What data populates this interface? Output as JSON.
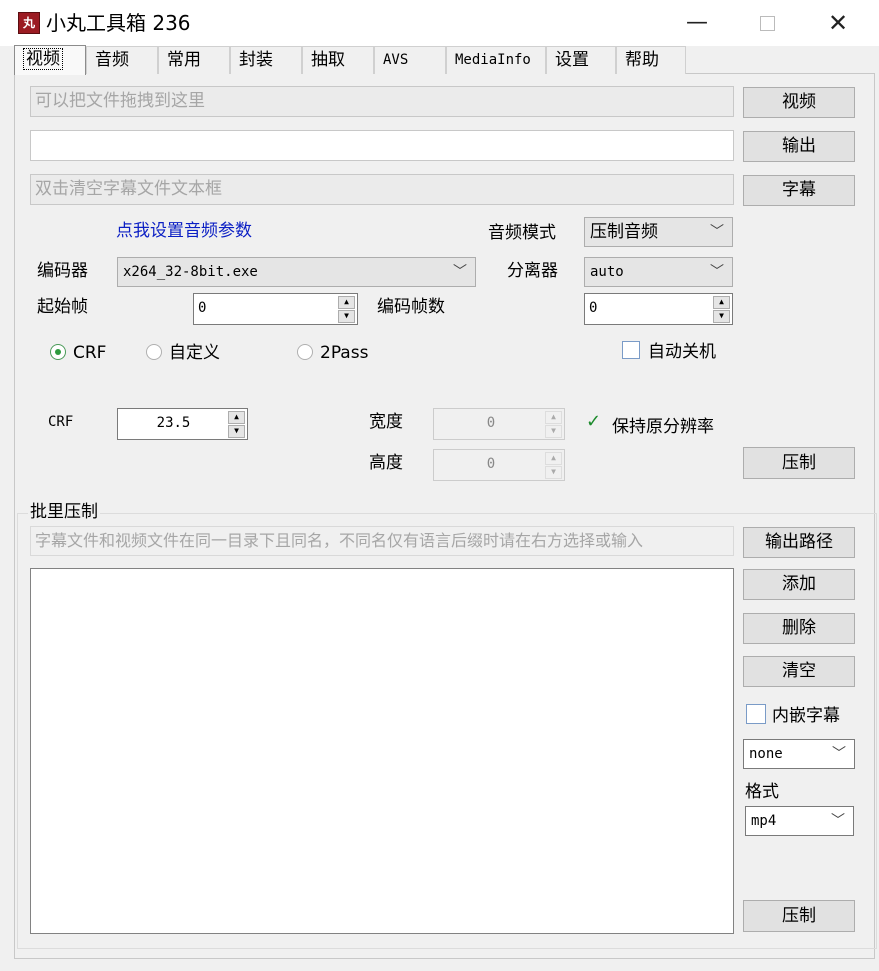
{
  "window": {
    "title": "小丸工具箱 236",
    "icon_label": "丸",
    "minimize_glyph": "—",
    "close_glyph": "✕"
  },
  "tabs": [
    {
      "label": "视频",
      "active": true
    },
    {
      "label": "音频"
    },
    {
      "label": "常用"
    },
    {
      "label": "封装"
    },
    {
      "label": "抽取"
    },
    {
      "label": "AVS"
    },
    {
      "label": "MediaInfo"
    },
    {
      "label": "设置"
    },
    {
      "label": "帮助"
    }
  ],
  "video": {
    "input_placeholder": "可以把文件拖拽到这里",
    "video_button": "视频",
    "output_value": "",
    "output_button": "输出",
    "subtitle_placeholder": "双击清空字幕文件文本框",
    "subtitle_button": "字幕",
    "audio_params_link": "点我设置音频参数",
    "audio_mode_label": "音频模式",
    "audio_mode_value": "压制音频",
    "encoder_label": "编码器",
    "encoder_value": "x264_32-8bit.exe",
    "splitter_label": "分离器",
    "splitter_value": "auto",
    "start_frame_label": "起始帧",
    "start_frame_value": "0",
    "frame_count_label": "编码帧数",
    "frame_count_value": "0",
    "radio_crf": "CRF",
    "radio_custom": "自定义",
    "radio_2pass": "2Pass",
    "auto_shutdown_label": "自动关机",
    "crf_label": "CRF",
    "crf_value": "23.5",
    "width_label": "宽度",
    "width_value": "0",
    "height_label": "高度",
    "height_value": "0",
    "keep_resolution_label": "保持原分辨率",
    "encode_button": "压制"
  },
  "batch": {
    "legend": "批里压制",
    "hint_placeholder": "字幕文件和视频文件在同一目录下且同名，不同名仅有语言后缀时请在右方选择或输入",
    "output_path_button": "输出路径",
    "add_button": "添加",
    "delete_button": "删除",
    "clear_button": "清空",
    "embed_subtitle_label": "内嵌字幕",
    "subtitle_lang_value": "none",
    "format_label": "格式",
    "format_value": "mp4",
    "encode_button": "压制"
  }
}
